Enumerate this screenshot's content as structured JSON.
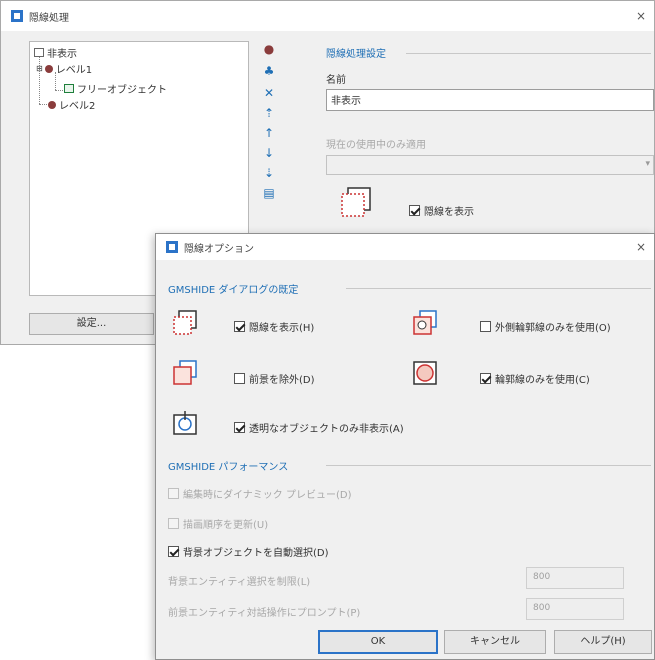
{
  "back_window": {
    "title": "隠線処理",
    "close_glyph": "×",
    "tree": [
      {
        "label": "非表示"
      },
      {
        "label": "レベル1"
      },
      {
        "label": "フリーオブジェクト"
      },
      {
        "label": "レベル2"
      }
    ],
    "settings_group_title": "隠線処理設定",
    "name_label": "名前",
    "name_value": "非表示",
    "applies_label": "現在の使用中のみ適用",
    "show_hidden_checkbox": {
      "label": "隠線を表示",
      "checked": true
    },
    "settings_button": "設定..."
  },
  "front_dialog": {
    "title": "隠線オプション",
    "close_glyph": "×",
    "group1_title": "GMSHIDE ダイアログの既定",
    "options": [
      {
        "label": "隠線を表示(H)",
        "checked": true
      },
      {
        "label": "外側輪郭線のみを使用(O)",
        "checked": false
      },
      {
        "label": "前景を除外(D)",
        "checked": false
      },
      {
        "label": "輪郭線のみを使用(C)",
        "checked": true
      },
      {
        "label": "透明なオブジェクトのみ非表示(A)",
        "checked": true
      }
    ],
    "group2_title": "GMSHIDE パフォーマンス",
    "perf": [
      {
        "label": "編集時にダイナミック プレビュー(D)",
        "checked": false,
        "disabled": true
      },
      {
        "label": "描画順序を更新(U)",
        "checked": false,
        "disabled": true
      },
      {
        "label": "背景オブジェクトを自動選択(D)",
        "checked": true,
        "disabled": false
      }
    ],
    "limit_rows": [
      {
        "label": "背景エンティティ選択を制限(L)",
        "value": "800"
      },
      {
        "label": "前景エンティティ対話操作にプロンプト(P)",
        "value": "800"
      }
    ],
    "buttons": {
      "ok": "OK",
      "cancel": "キャンセル",
      "help": "ヘルプ(H)"
    }
  },
  "colors": {
    "accent": "#1f6fb5",
    "frame": "#2b73c8"
  }
}
